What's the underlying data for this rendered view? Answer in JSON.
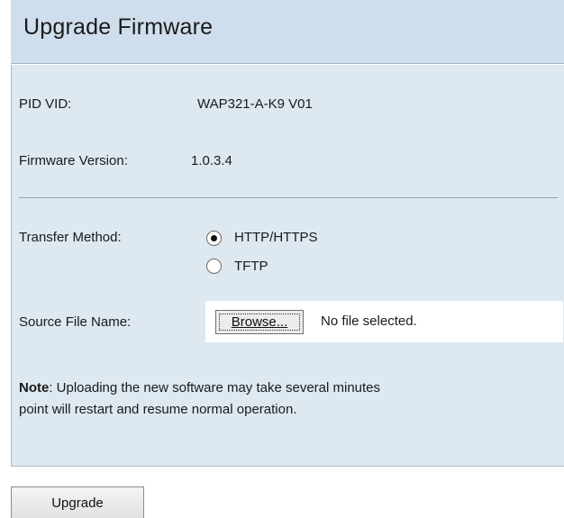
{
  "header": {
    "title": "Upgrade Firmware"
  },
  "info": {
    "pid_vid_label": "PID VID:",
    "pid_vid_value": "WAP321-A-K9 V01",
    "firmware_version_label": "Firmware Version:",
    "firmware_version_value": "1.0.3.4"
  },
  "transfer_method": {
    "label": "Transfer Method:",
    "options": [
      {
        "label": "HTTP/HTTPS",
        "selected": true
      },
      {
        "label": "TFTP",
        "selected": false
      }
    ]
  },
  "source_file": {
    "label": "Source File Name:",
    "browse_label": "Browse...",
    "status": "No file selected."
  },
  "note": {
    "prefix": "Note",
    "line1": ": Uploading the new software may take several minutes",
    "line2": "point will restart and resume normal operation."
  },
  "actions": {
    "upgrade_label": "Upgrade"
  },
  "colors": {
    "header_bg": "#cfdeec",
    "panel_bg": "#dde8f1"
  }
}
